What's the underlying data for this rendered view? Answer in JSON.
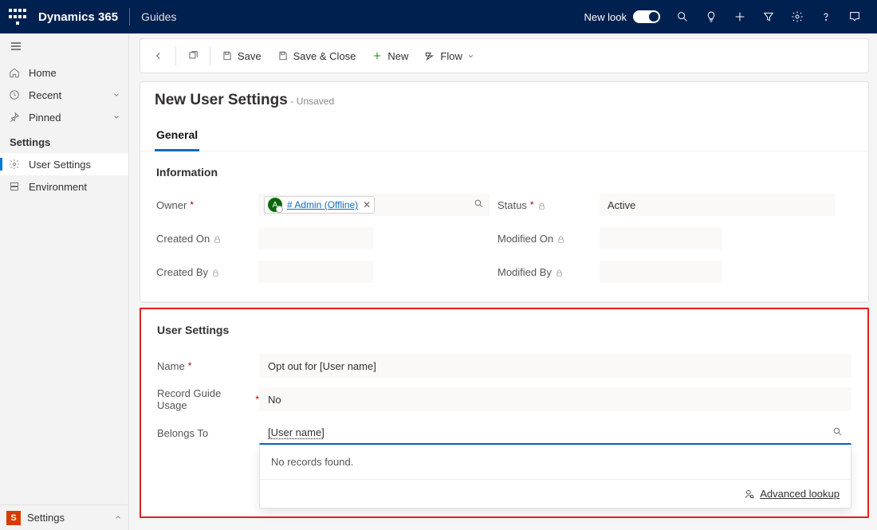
{
  "topbar": {
    "brand": "Dynamics 365",
    "subbrand": "Guides",
    "new_look": "New look"
  },
  "leftnav": {
    "home": "Home",
    "recent": "Recent",
    "pinned": "Pinned",
    "group_settings": "Settings",
    "user_settings": "User Settings",
    "environment": "Environment",
    "area_letter": "S",
    "area_label": "Settings"
  },
  "cmdbar": {
    "save": "Save",
    "save_close": "Save & Close",
    "new": "New",
    "flow": "Flow"
  },
  "header": {
    "title": "New User Settings",
    "subtitle": "- Unsaved"
  },
  "tabs": {
    "general": "General"
  },
  "section_info": {
    "title": "Information",
    "owner_label": "Owner",
    "owner_value": "# Admin (Offline)",
    "owner_avatar": "A",
    "created_on": "Created On",
    "created_by": "Created By",
    "status_label": "Status",
    "status_value": "Active",
    "modified_on": "Modified On",
    "modified_by": "Modified By"
  },
  "section_user": {
    "title": "User Settings",
    "name_label": "Name",
    "name_value": "Opt out for [User name]",
    "record_usage_label": "Record Guide Usage",
    "record_usage_value": "No",
    "belongs_label": "Belongs To",
    "belongs_value": "[User name]",
    "lookup_empty": "No records found.",
    "advanced_lookup": "Advanced lookup"
  }
}
